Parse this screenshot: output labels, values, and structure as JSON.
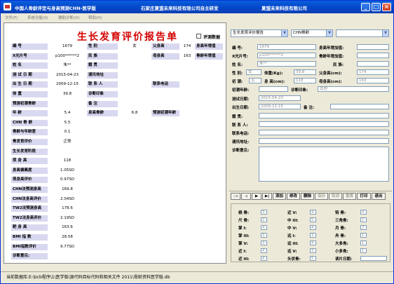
{
  "window": {
    "title_app": "中国人骨龄评定与身高预测CHN-医学版",
    "title_dev": "石家庄夏盟未来科技有限公司自主研发",
    "title_company": "夏盟未来科技有限公司",
    "min": "_",
    "max": "□",
    "close": "×"
  },
  "menu": [
    "文件(F)",
    "系统功能(S)",
    "辅助诊断(D)",
    "帮助(H)"
  ],
  "report": {
    "title": "生长发育评价报告单",
    "eval_data_label": "评测数据"
  },
  "left_rows": [
    {
      "l1": "编 号",
      "v1": "1679",
      "l2": "性 别",
      "v2": "女",
      "l3": "父身高",
      "v3": "174",
      "l4": "身高年增值",
      "v4": ""
    },
    {
      "l1": "X光片号",
      "v1": "p100******2",
      "l2": "民 族",
      "v2": "",
      "l3": "母身高",
      "v3": "163",
      "l4": "骨龄年增值",
      "v4": ""
    },
    {
      "l1": "姓 名",
      "v1": "朱**",
      "l2": "籍 贯",
      "v2": ""
    },
    {
      "l1": "测 试 日 期",
      "v1": "2015-04-23",
      "l2": "通讯地址",
      "v2": ""
    },
    {
      "l1": "出 生 日 期",
      "v1": "2009-12-15",
      "l2": "联 系 人",
      "v2": "",
      "l3": "联系电话",
      "v3": ""
    },
    {
      "l1": "体 重",
      "v1": "39.8",
      "l2": "诊断印象",
      "v2": ""
    },
    {
      "l1": "预测初潮骨龄",
      "v1": "",
      "l2": "备 注",
      "v2": ""
    },
    {
      "l1": "年 龄",
      "v1": "5.4",
      "l2": "身高骨龄",
      "v2": "6.8",
      "l3": "预测初潮年龄",
      "v3": ""
    },
    {
      "l1": "CHN 骨 龄",
      "v1": "5.5"
    },
    {
      "l1": "骨龄与年龄差",
      "v1": "0.1"
    },
    {
      "l1": "骨发育评价",
      "v1": "正常"
    },
    {
      "l1": "生长发育阶段",
      "v1": ""
    },
    {
      "l1": "现 身 高",
      "v1": "118"
    },
    {
      "l1": "身高偏离度",
      "v1": "1.05SD"
    },
    {
      "l1": "现身高评价",
      "v1": "0.97SD"
    },
    {
      "l1": "CHN法预测身高",
      "v1": "169.8"
    },
    {
      "l1": "CHN法身高评价",
      "v1": "2.04SD"
    },
    {
      "l1": "TW2法预测身高",
      "v1": "178.6"
    },
    {
      "l1": "TW2法身高评价",
      "v1": "2.19SD"
    },
    {
      "l1": "靶 身 高",
      "v1": "163.6"
    },
    {
      "l1": "BMI 指 数",
      "v1": "28.58"
    },
    {
      "l1": "BMI指数评价",
      "v1": "9.77SD"
    },
    {
      "l1": "诊断意见:",
      "v1": ""
    }
  ],
  "right": {
    "combo1": "生长发育评价报告",
    "combo2": "CHN骨龄",
    "combo3": "",
    "fields": {
      "id_label": "编 号:",
      "id": "1679",
      "height_inc_label": "身高年增加值:",
      "xray_label": "X光片号:",
      "xray": "p100******2",
      "bone_inc_label": "骨龄年增加值:",
      "name_label": "姓 名:",
      "name": "朱**",
      "ethnic_label": "民 族:",
      "sex_label": "性 别:",
      "sex": "女",
      "weight_label": "体重(Kg):",
      "weight": "39.8",
      "father_label": "父身高(cm):",
      "father": "174",
      "menarche_label": "初 潮:",
      "menarche": "否",
      "height_label": "身 高(cm):",
      "height": "118",
      "mother_label": "母身高(cm):",
      "mother": "163",
      "menarche_date_label": "初潮年龄:",
      "diag_label": "诊断印象:",
      "diag": "其他",
      "test_date_label": "测试日期:",
      "test_date": "2015-04-23",
      "birth_label": "出生日期:",
      "birth": "2009-12-15",
      "note_label": "备 注:",
      "origin_label": "籍 贯:",
      "contact_label": "联 系 人:",
      "phone_label": "联系电话:",
      "address_label": "通讯地址:",
      "opinion_label": "诊断意见:"
    },
    "nav": [
      "|◀",
      "◀",
      "▶",
      "▶|",
      "添加",
      "修改",
      "删除",
      "保存",
      "取消",
      "重算",
      "打印",
      "退出"
    ],
    "bones": [
      {
        "a": "桡 骨:",
        "av": "3",
        "b": "近 V:",
        "bv": "4",
        "c": "钩 骨:",
        "cv": "4"
      },
      {
        "a": "尺 骨:",
        "av": "2",
        "b": "中 III:",
        "bv": "5",
        "c": "三角骨:",
        "cv": "2"
      },
      {
        "a": "掌 I:",
        "av": "4",
        "b": "中 V:",
        "bv": "4",
        "c": "月 骨:",
        "cv": "2"
      },
      {
        "a": "掌 III:",
        "av": "3",
        "b": "远 I:",
        "bv": "3",
        "c": "舟 骨:",
        "cv": "1"
      },
      {
        "a": "掌 V:",
        "av": "3",
        "b": "远 III:",
        "bv": "4",
        "c": "大多角:",
        "cv": "1"
      },
      {
        "a": "近 I:",
        "av": "4",
        "b": "远 V:",
        "bv": "3",
        "c": "小多角:",
        "cv": "1"
      },
      {
        "a": "近 III:",
        "av": "4",
        "b": "头状骨:",
        "bv": "5",
        "c": "读片日期:",
        "cv": ""
      }
    ]
  },
  "status": "当前数据库:E:\\bcb程序\\1\\医学版\\源代码目标代码和相关文件 2011\\骨龄资料医学版.db",
  "colors": {
    "title_red": "#d30000",
    "label_bg": "#d8d8f0",
    "titlebar": "#0446c8"
  }
}
